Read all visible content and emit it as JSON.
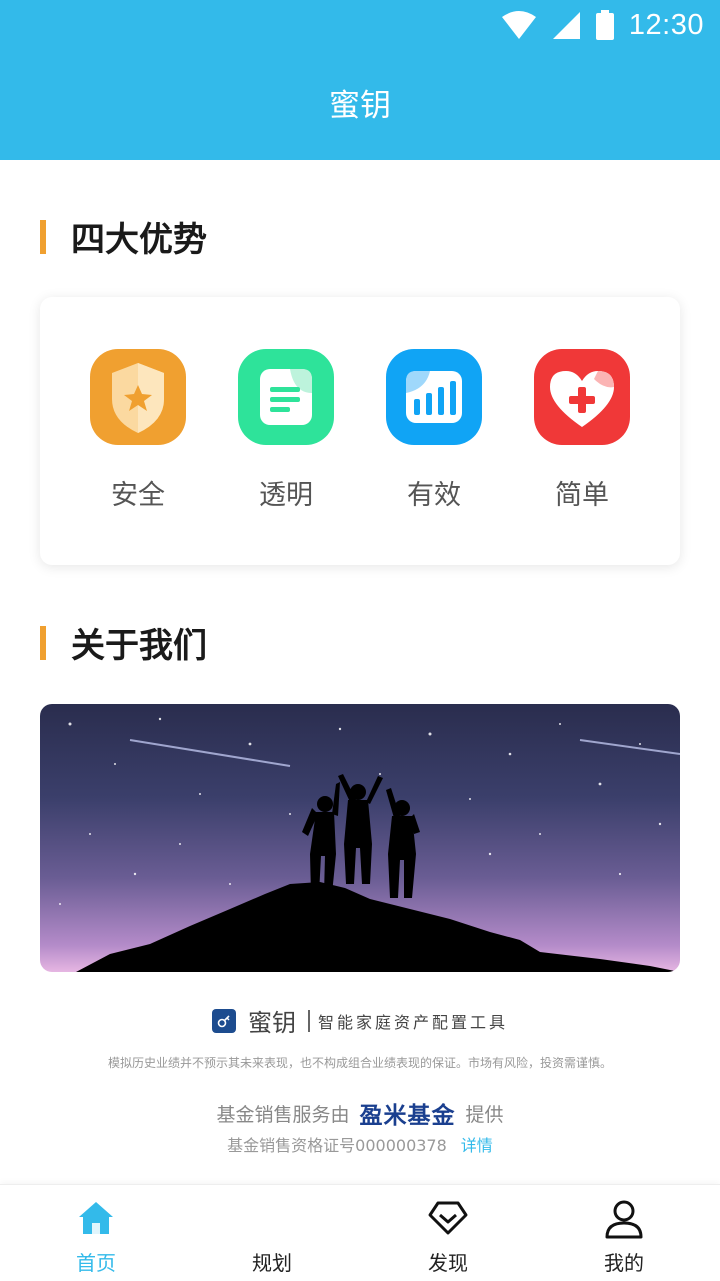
{
  "status": {
    "time": "12:30"
  },
  "appbar": {
    "title": "蜜钥"
  },
  "advantages": {
    "heading": "四大优势",
    "items": [
      {
        "label": "安全",
        "icon": "shield-star-icon",
        "color": "#f0a030"
      },
      {
        "label": "透明",
        "icon": "document-icon",
        "color": "#2ee39a"
      },
      {
        "label": "有效",
        "icon": "bar-chart-icon",
        "color": "#10a4f5"
      },
      {
        "label": "简单",
        "icon": "heart-plus-icon",
        "color": "#f03838"
      }
    ]
  },
  "about": {
    "heading": "关于我们",
    "brand_name": "蜜钥",
    "slogan": "智能家庭资产配置工具",
    "disclaimer": "模拟历史业绩并不预示其未来表现，也不构成组合业绩表现的保证。市场有风险，投资需谨慎。",
    "service_prefix": "基金销售服务由",
    "fund_logo_text": "盈米基金",
    "service_suffix": "提供",
    "license_text": "基金销售资格证号000000378",
    "license_link": "详情"
  },
  "tabs": [
    {
      "label": "首页",
      "icon": "home-icon",
      "active": true
    },
    {
      "label": "规划",
      "icon": "",
      "active": false
    },
    {
      "label": "发现",
      "icon": "diamond-icon",
      "active": false
    },
    {
      "label": "我的",
      "icon": "user-icon",
      "active": false
    }
  ],
  "colors": {
    "primary": "#33baea",
    "accent": "#f0a030"
  }
}
